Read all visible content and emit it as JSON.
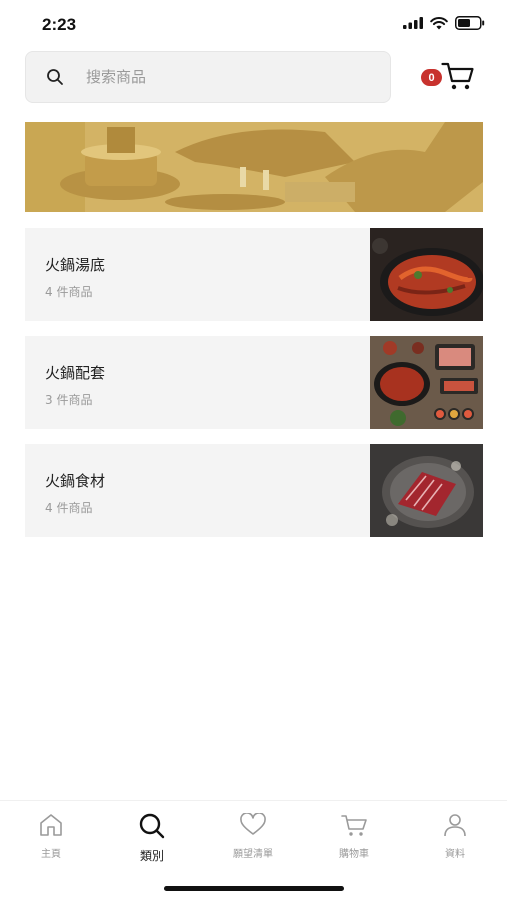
{
  "status_bar": {
    "time": "2:23"
  },
  "search": {
    "placeholder": "搜索商品"
  },
  "cart": {
    "count": "0"
  },
  "categories": [
    {
      "name": "火鍋湯底",
      "count": "4 件商品"
    },
    {
      "name": "火鍋配套",
      "count": "3 件商品"
    },
    {
      "name": "火鍋食材",
      "count": "4 件商品"
    }
  ],
  "tab_bar": {
    "items": [
      {
        "label": "主頁",
        "icon": "home-icon"
      },
      {
        "label": "類別",
        "icon": "search-icon"
      },
      {
        "label": "願望清單",
        "icon": "heart-icon"
      },
      {
        "label": "購物車",
        "icon": "cart-icon"
      },
      {
        "label": "資料",
        "icon": "user-icon"
      }
    ],
    "active_index": 1
  },
  "colors": {
    "badge": "#c8322e",
    "banner": "#d2b163",
    "card_bg": "#f4f4f4"
  }
}
